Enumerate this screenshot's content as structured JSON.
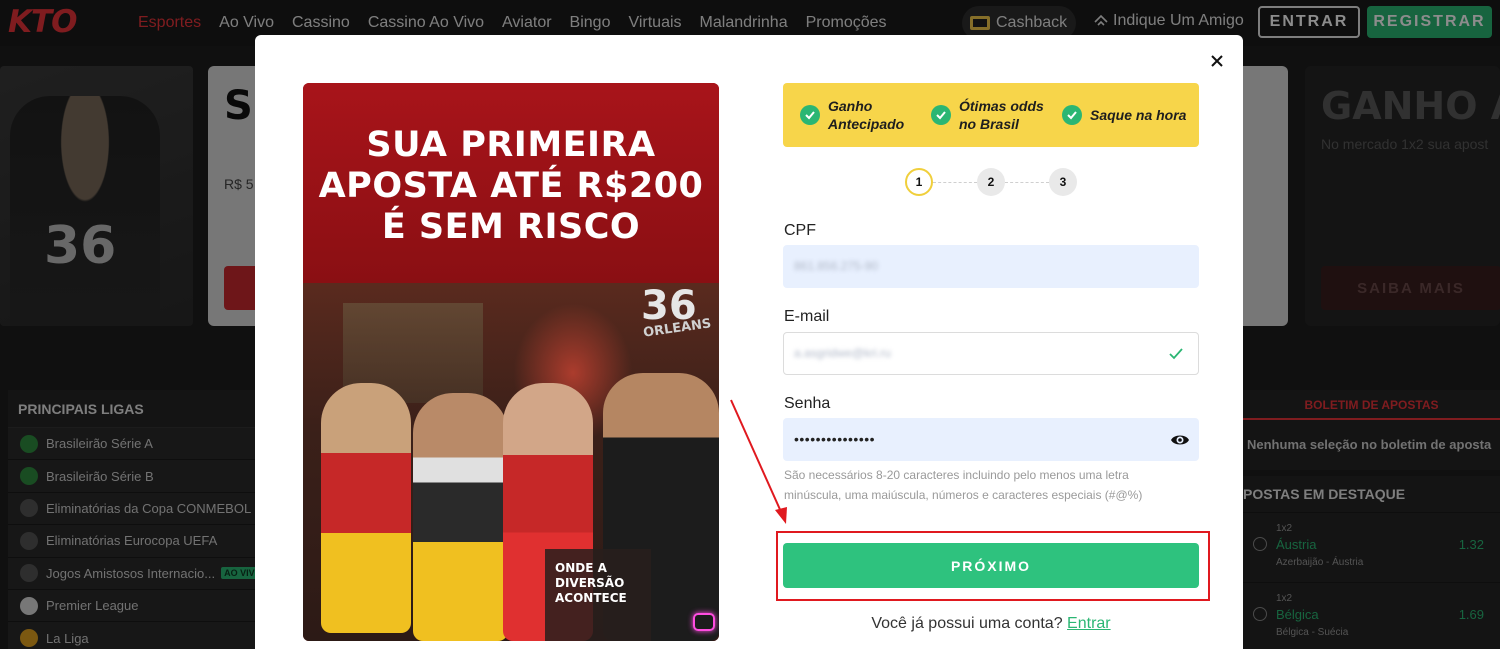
{
  "header": {
    "logo": "KTO",
    "nav": [
      "Esportes",
      "Ao Vivo",
      "Cassino",
      "Cassino Ao Vivo",
      "Aviator",
      "Bingo",
      "Virtuais",
      "Malandrinha",
      "Promoções"
    ],
    "cashback": "Cashback",
    "indique": "Indique Um Amigo",
    "entrar": "ENTRAR",
    "registrar": "REGISTRAR"
  },
  "background": {
    "card_mid_title": "SI VS",
    "card_mid_sub": "R$ 5",
    "card_right_title": "GANHO AN",
    "card_right_sub": "No mercado 1x2 sua apost",
    "card_right_btn": "SAIBA MAIS",
    "jersey_number": "36",
    "leagues_title": "PRINCIPAIS LIGAS",
    "leagues": [
      {
        "name": "Brasileirão Série A",
        "flag": "#2e8b3e",
        "live": ""
      },
      {
        "name": "Brasileirão Série B",
        "flag": "#2e8b3e",
        "live": ""
      },
      {
        "name": "Eliminatórias da Copa CONMEBOL",
        "flag": "#555555",
        "live": ""
      },
      {
        "name": "Eliminatórias Eurocopa UEFA",
        "flag": "#555555",
        "live": ""
      },
      {
        "name": "Jogos Amistosos Internacio...",
        "flag": "#555555",
        "live": "AO VIVO"
      },
      {
        "name": "Premier League",
        "flag": "#d9d9d9",
        "live": ""
      },
      {
        "name": "La Liga",
        "flag": "#e0a020",
        "live": ""
      }
    ],
    "betslip_title": "BOLETIM DE APOSTAS",
    "betslip_empty": "Nenhuma seleção no boletim de aposta",
    "featured_title": "POSTAS EM DESTAQUE",
    "featured": [
      {
        "market": "1x2",
        "selection": "Áustria",
        "odd": "1.32",
        "match": "Azerbaijão - Áustria"
      },
      {
        "market": "1x2",
        "selection": "Bélgica",
        "odd": "1.69",
        "match": "Bélgica - Suécia"
      }
    ]
  },
  "modal": {
    "promo_headline": "SUA PRIMEIRA APOSTA ATÉ R$200 É SEM RISCO",
    "promo_tag": "ONDE A DIVERSÃO ACONTECE",
    "promo_jersey_number": "36",
    "promo_jersey_name": "ORLEANS",
    "benefits": [
      "Ganho Antecipado",
      "Ótimas odds no Brasil",
      "Saque na hora"
    ],
    "steps": [
      "1",
      "2",
      "3"
    ],
    "cpf_label": "CPF",
    "cpf_value": "861.856.275-90",
    "email_label": "E-mail",
    "email_value": "a.asgridwe@kri.ru",
    "password_label": "Senha",
    "password_value": "•••••••••••••••",
    "password_hint": "São necessários 8-20 caracteres incluindo pelo menos uma letra minúscula, uma maiúscula, números e caracteres especiais (#@%)",
    "next_button": "PRÓXIMO",
    "login_prompt": "Você já possui uma conta?",
    "login_link": "Entrar"
  },
  "colors": {
    "brand_red": "#e8333a",
    "green": "#2bb673",
    "benefit_yellow": "#f7d54a",
    "highlight_red": "#e0191f"
  }
}
